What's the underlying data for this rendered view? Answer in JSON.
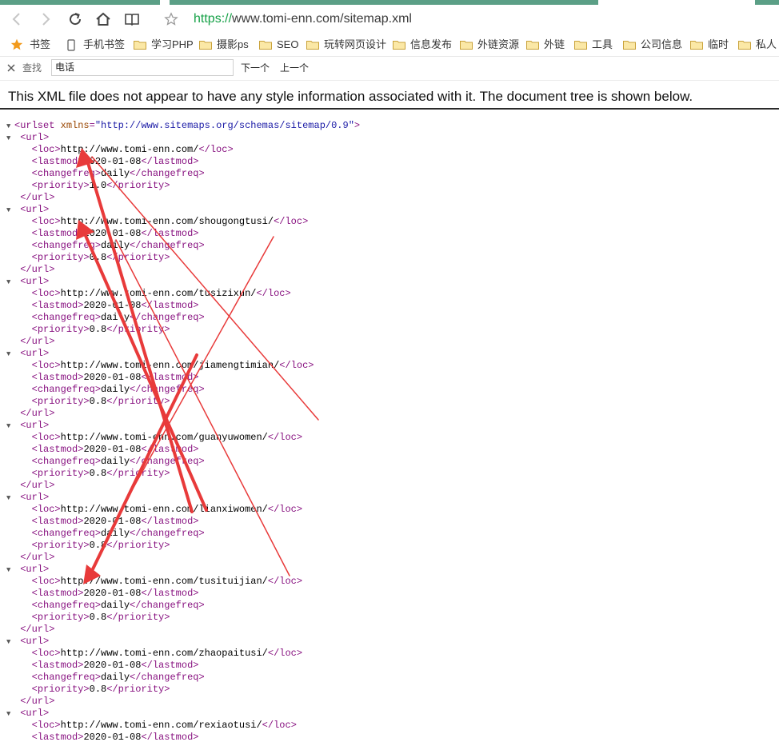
{
  "browser": {
    "url_protocol": "https://",
    "url_rest": "www.tomi-enn.com/sitemap.xml",
    "accent_color": "#14a046"
  },
  "nav": {
    "back_icon": "chevron-left-icon",
    "forward_icon": "chevron-right-icon",
    "reload_icon": "reload-icon",
    "home_icon": "home-icon",
    "reader_icon": "book-icon",
    "favorite_icon": "star-icon"
  },
  "bookmarks": {
    "items": [
      {
        "label": "书签",
        "icon": "star-icon"
      },
      {
        "label": "手机书签",
        "icon": "phone-icon"
      },
      {
        "label": "学习PHP",
        "icon": "folder-icon"
      },
      {
        "label": "摄影ps",
        "icon": "folder-icon"
      },
      {
        "label": "SEO",
        "icon": "folder-icon"
      },
      {
        "label": "玩转网页设计",
        "icon": "folder-icon"
      },
      {
        "label": "信息发布",
        "icon": "folder-icon"
      },
      {
        "label": "外链资源",
        "icon": "folder-icon"
      },
      {
        "label": "外链",
        "icon": "folder-icon"
      },
      {
        "label": "工具",
        "icon": "folder-icon"
      },
      {
        "label": "公司信息",
        "icon": "folder-icon"
      },
      {
        "label": "临时",
        "icon": "folder-icon"
      },
      {
        "label": "私人",
        "icon": "folder-icon"
      }
    ]
  },
  "findbar": {
    "label": "查找",
    "value": "电话",
    "next_label": "下一个",
    "prev_label": "上一个"
  },
  "page": {
    "notice": "This XML file does not appear to have any style information associated with it. The document tree is shown below.",
    "root_open": "<urlset",
    "root_attr_name": "xmlns",
    "root_attr_value": "\"http://www.sitemaps.org/schemas/sitemap/0.9\"",
    "tag_url": "url",
    "tag_loc": "loc",
    "tag_lastmod": "lastmod",
    "tag_changefreq": "changefreq",
    "tag_priority": "priority",
    "urls": [
      {
        "loc": "http://www.tomi-enn.com/",
        "lastmod": "2020-01-08",
        "changefreq": "daily",
        "priority": "1.0"
      },
      {
        "loc": "http://www.tomi-enn.com/shougongtusi/",
        "lastmod": "2020-01-08",
        "changefreq": "daily",
        "priority": "0.8"
      },
      {
        "loc": "http://www.tomi-enn.com/tusizixun/",
        "lastmod": "2020-01-08",
        "changefreq": "daily",
        "priority": "0.8"
      },
      {
        "loc": "http://www.tomi-enn.com/jiamengtimian/",
        "lastmod": "2020-01-08",
        "changefreq": "daily",
        "priority": "0.8"
      },
      {
        "loc": "http://www.tomi-enn.com/guanyuwomen/",
        "lastmod": "2020-01-08",
        "changefreq": "daily",
        "priority": "0.8"
      },
      {
        "loc": "http://www.tomi-enn.com/lianxiwomen/",
        "lastmod": "2020-01-08",
        "changefreq": "daily",
        "priority": "0.8"
      },
      {
        "loc": "http://www.tomi-enn.com/tusituijian/",
        "lastmod": "2020-01-08",
        "changefreq": "daily",
        "priority": "0.8"
      },
      {
        "loc": "http://www.tomi-enn.com/zhaopaitusi/",
        "lastmod": "2020-01-08",
        "changefreq": "daily",
        "priority": "0.8"
      },
      {
        "loc": "http://www.tomi-enn.com/rexiaotusi/",
        "lastmod": "2020-01-08"
      }
    ]
  },
  "annotation": {
    "color": "#e83a3a"
  }
}
